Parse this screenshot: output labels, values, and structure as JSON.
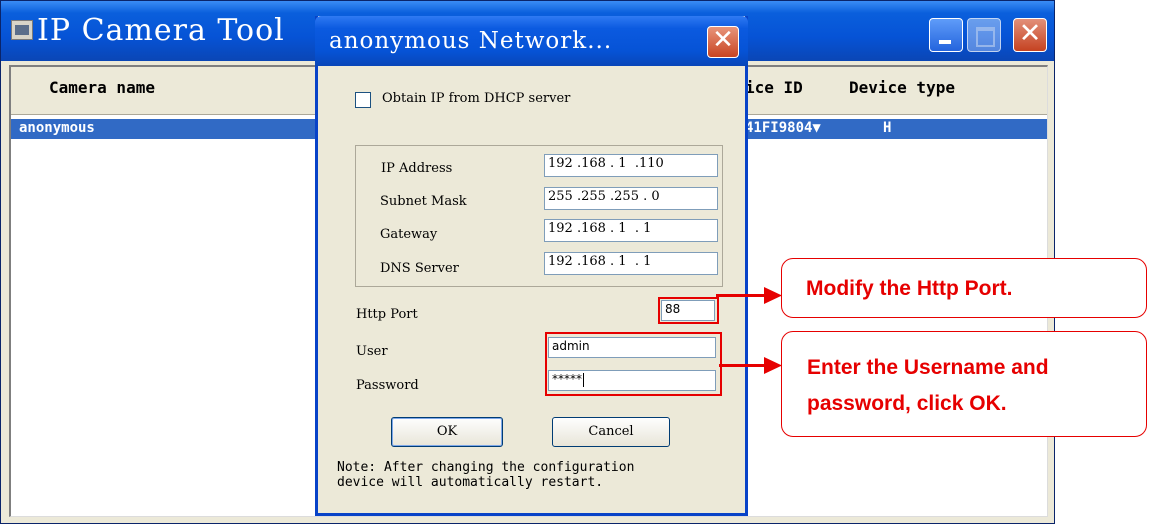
{
  "main_window": {
    "title": "IP Camera Tool",
    "columns": [
      "Camera name",
      "ice ID",
      "Device type"
    ],
    "rows": [
      {
        "name": "anonymous",
        "id": "41FI9804▼",
        "type": "H"
      }
    ]
  },
  "dialog": {
    "title": "anonymous Network...",
    "dhcp_label": "Obtain IP from DHCP server",
    "dhcp_checked": false,
    "ip_fields": [
      {
        "label": "IP Address",
        "value": "192 .168 . 1  .110"
      },
      {
        "label": "Subnet Mask",
        "value": "255 .255 .255 . 0"
      },
      {
        "label": "Gateway",
        "value": "192 .168 . 1  . 1"
      },
      {
        "label": "DNS Server",
        "value": "192 .168 . 1  . 1"
      }
    ],
    "http_port_label": "Http Port",
    "http_port_value": "88",
    "user_label": "User",
    "user_value": "admin",
    "password_label": "Password",
    "password_value": "*****",
    "ok_label": "OK",
    "cancel_label": "Cancel",
    "note": "Note: After changing the configuration\ndevice will automatically restart."
  },
  "callouts": {
    "port": "Modify the Http Port.",
    "credentials_line1": "Enter the Username and",
    "credentials_line2": "password, click OK."
  },
  "colors": {
    "title_bar": "#0653d6",
    "selection": "#316ac5",
    "annotation": "#e60000",
    "window_bg": "#ece9d8"
  }
}
